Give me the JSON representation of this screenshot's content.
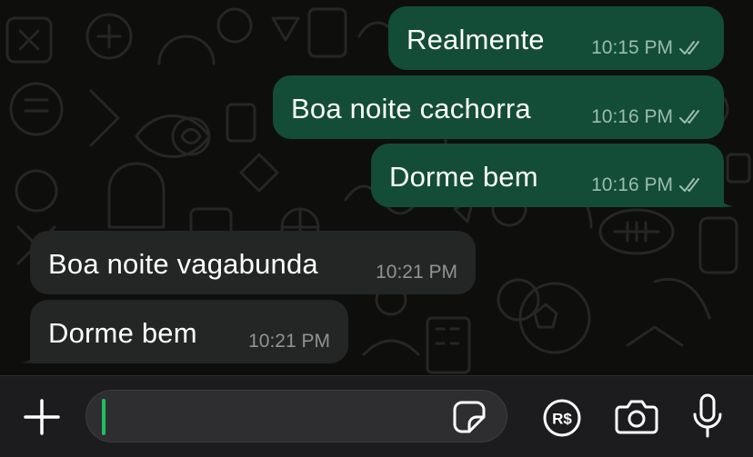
{
  "chat": {
    "messages": [
      {
        "direction": "outgoing",
        "text": "Realmente",
        "time": "10:15 PM",
        "status_icon": "double-check-icon"
      },
      {
        "direction": "outgoing",
        "text": "Boa noite cachorra",
        "time": "10:16 PM",
        "status_icon": "double-check-icon"
      },
      {
        "direction": "outgoing",
        "text": "Dorme bem",
        "time": "10:16 PM",
        "status_icon": "double-check-icon"
      },
      {
        "direction": "incoming",
        "text": "Boa noite vagabunda",
        "time": "10:21 PM"
      },
      {
        "direction": "incoming",
        "text": "Dorme bem",
        "time": "10:21 PM"
      }
    ]
  },
  "composer": {
    "input_value": "",
    "icons": [
      "plus-icon",
      "sticker-icon",
      "payment-icon",
      "camera-icon",
      "microphone-icon"
    ]
  },
  "colors": {
    "chat_background": "#0e0e0d",
    "outgoing_bubble": "#134d37",
    "incoming_bubble": "#242626",
    "composer_background": "#1c1c1e",
    "caret": "#21c063"
  }
}
